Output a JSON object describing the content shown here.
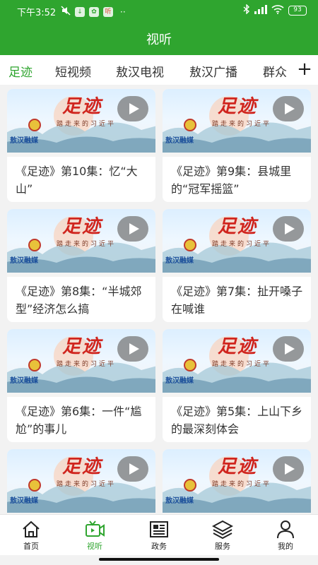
{
  "status": {
    "time": "下午3:52",
    "icons": [
      "muted-icon",
      "download-icon",
      "app-icon",
      "radio-icon"
    ],
    "more": "··",
    "battery": "93"
  },
  "header": {
    "title": "视听"
  },
  "tabs": [
    {
      "label": "足迹",
      "active": true
    },
    {
      "label": "短视频",
      "active": false
    },
    {
      "label": "敖汉电视",
      "active": false
    },
    {
      "label": "敖汉广播",
      "active": false
    },
    {
      "label": "群众",
      "active": false
    }
  ],
  "tabs_add": "+",
  "cards": [
    {
      "title": "《足迹》第10集：忆“大山”"
    },
    {
      "title": "《足迹》第9集：县城里的“冠军摇篮”"
    },
    {
      "title": "《足迹》第8集：“半城郊型”经济怎么搞"
    },
    {
      "title": "《足迹》第7集：扯开嗓子在喊谁"
    },
    {
      "title": "《足迹》第6集：一件“尴尬”的事儿"
    },
    {
      "title": "《足迹》第5集：上山下乡的最深刻体会"
    },
    {
      "title": ""
    },
    {
      "title": ""
    }
  ],
  "thumbnail": {
    "heading": "足迹",
    "subtitle": "踏走来的习近平",
    "brand": "敖汉融媒"
  },
  "nav": [
    {
      "label": "首页",
      "icon": "home-icon",
      "active": false
    },
    {
      "label": "视听",
      "icon": "tv-icon",
      "active": true
    },
    {
      "label": "政务",
      "icon": "newspaper-icon",
      "active": false
    },
    {
      "label": "服务",
      "icon": "layers-icon",
      "active": false
    },
    {
      "label": "我的",
      "icon": "person-icon",
      "active": false
    }
  ],
  "colors": {
    "accent": "#2fa52f"
  }
}
